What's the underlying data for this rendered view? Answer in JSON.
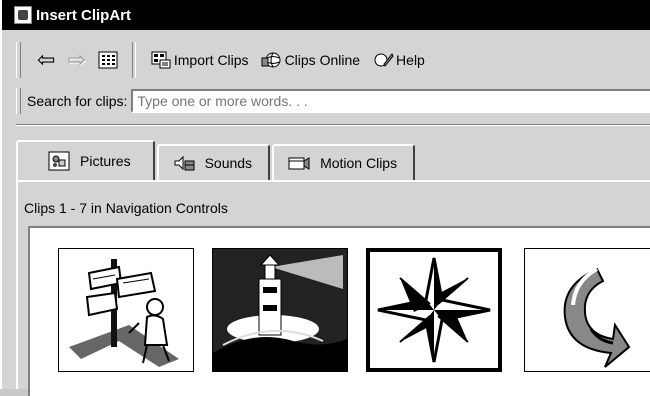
{
  "window": {
    "title": "Insert ClipArt"
  },
  "toolbar": {
    "back_icon": "back-arrow-icon",
    "forward_icon": "forward-arrow-icon",
    "view_icon": "grid-view-icon",
    "import_label": "Import Clips",
    "online_label": "Clips Online",
    "help_label": "Help"
  },
  "search": {
    "label": "Search for clips:",
    "placeholder": "Type one or more words. . .",
    "value": ""
  },
  "tabs": [
    {
      "label": "Pictures",
      "active": true
    },
    {
      "label": "Sounds",
      "active": false
    },
    {
      "label": "Motion Clips",
      "active": false
    }
  ],
  "status_text": "Clips 1 - 7 in Navigation Controls",
  "clips": [
    {
      "subject": "signpost-with-person-clip",
      "selected": false
    },
    {
      "subject": "lighthouse-clip",
      "selected": false
    },
    {
      "subject": "compass-star-clip",
      "selected": true
    },
    {
      "subject": "curved-arrow-clip",
      "selected": false
    }
  ]
}
